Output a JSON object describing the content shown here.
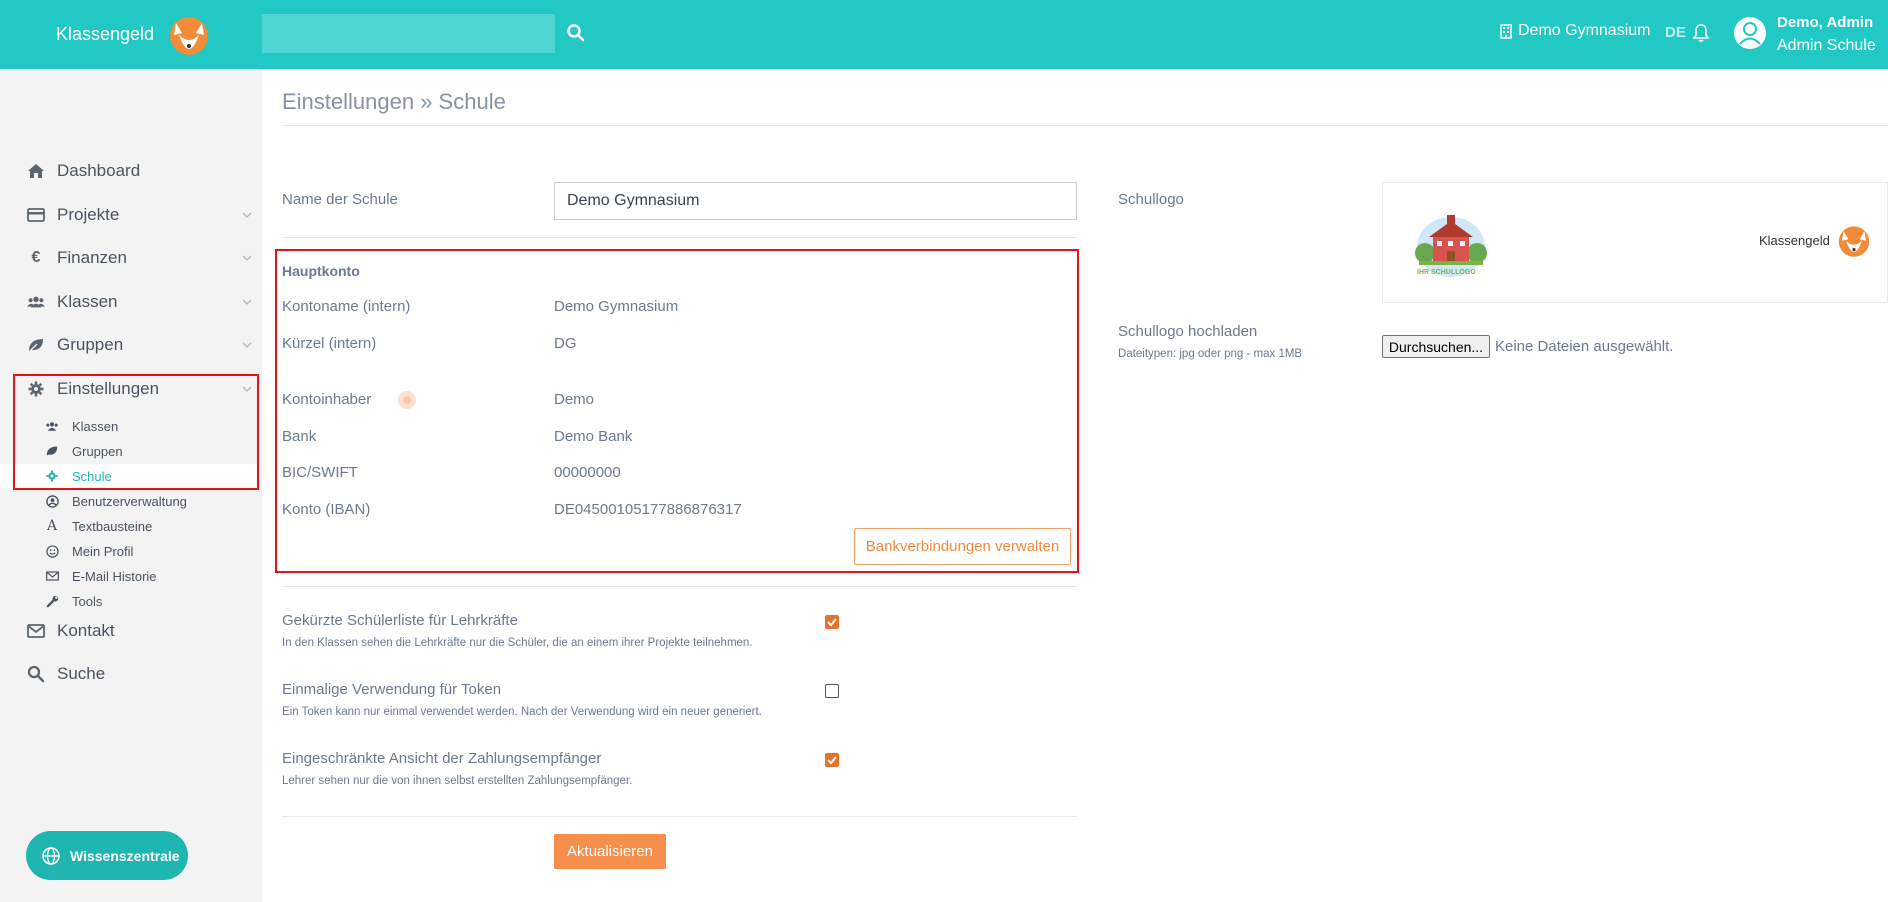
{
  "header": {
    "brand": "Klassengeld",
    "search_placeholder": "",
    "school": "Demo Gymnasium",
    "language": "DE",
    "user_name": "Demo, Admin",
    "user_role": "Admin Schule"
  },
  "sidebar": {
    "items": [
      {
        "label": "Dashboard",
        "icon": "home-icon"
      },
      {
        "label": "Projekte",
        "icon": "credit-card-icon"
      },
      {
        "label": "Finanzen",
        "icon": "euro-icon"
      },
      {
        "label": "Klassen",
        "icon": "users-icon"
      },
      {
        "label": "Gruppen",
        "icon": "leaf-icon"
      },
      {
        "label": "Einstellungen",
        "icon": "gear-icon"
      }
    ],
    "subitems": [
      {
        "label": "Klassen",
        "icon": "users-icon"
      },
      {
        "label": "Gruppen",
        "icon": "leaf-icon"
      },
      {
        "label": "Schule",
        "icon": "gear-icon",
        "active": true
      },
      {
        "label": "Benutzerverwaltung",
        "icon": "user-circle-icon"
      },
      {
        "label": "Textbausteine",
        "icon": "font-icon"
      },
      {
        "label": "Mein Profil",
        "icon": "smile-icon"
      },
      {
        "label": "E-Mail Historie",
        "icon": "envelope-icon"
      },
      {
        "label": "Tools",
        "icon": "wrench-icon"
      }
    ],
    "bottom_items": [
      {
        "label": "Kontakt",
        "icon": "envelope-icon"
      },
      {
        "label": "Suche",
        "icon": "search-icon"
      }
    ],
    "knowledge_button": "Wissenszentrale"
  },
  "main": {
    "breadcrumb": "Einstellungen » Schule",
    "school_name_label": "Name der Schule",
    "school_name_value": "Demo Gymnasium",
    "account": {
      "title": "Hauptkonto",
      "rows": [
        {
          "label": "Kontoname (intern)",
          "value": "Demo Gymnasium"
        },
        {
          "label": "Kürzel (intern)",
          "value": "DG"
        },
        {
          "label": "Kontoinhaber",
          "value": "Demo"
        },
        {
          "label": "Bank",
          "value": "Demo Bank"
        },
        {
          "label": "BIC/SWIFT",
          "value": "00000000"
        },
        {
          "label": "Konto (IBAN)",
          "value": "DE04500105177886876317"
        }
      ],
      "manage_button": "Bankverbindungen verwalten"
    },
    "options": [
      {
        "title": "Gekürzte Schülerliste für Lehrkräfte",
        "desc": "In den Klassen sehen die Lehrkräfte nur die Schüler, die an einem ihrer Projekte teilnehmen.",
        "checked": true
      },
      {
        "title": "Einmalige Verwendung für Token",
        "desc": "Ein Token kann nur einmal verwendet werden. Nach der Verwendung wird ein neuer generiert.",
        "checked": false
      },
      {
        "title": "Eingeschränkte Ansicht der Zahlungsempfänger",
        "desc": "Lehrer sehen nur die von ihnen selbst erstellten Zahlungsempfänger.",
        "checked": true
      }
    ],
    "submit_button": "Aktualisieren"
  },
  "logo_panel": {
    "label": "Schullogo",
    "placeholder_caption": "IHR SCHULLOGO",
    "brand_mark": "Klassengeld",
    "upload_label": "Schullogo hochladen",
    "upload_hint": "Dateitypen: jpg oder png - max 1MB",
    "file_button": "Durchsuchen...",
    "file_status": "Keine Dateien ausgewählt."
  },
  "colors": {
    "header": "#22c9c4",
    "accent": "#f58f4b",
    "highlight": "#e3121b",
    "active_link": "#22b6b1"
  }
}
